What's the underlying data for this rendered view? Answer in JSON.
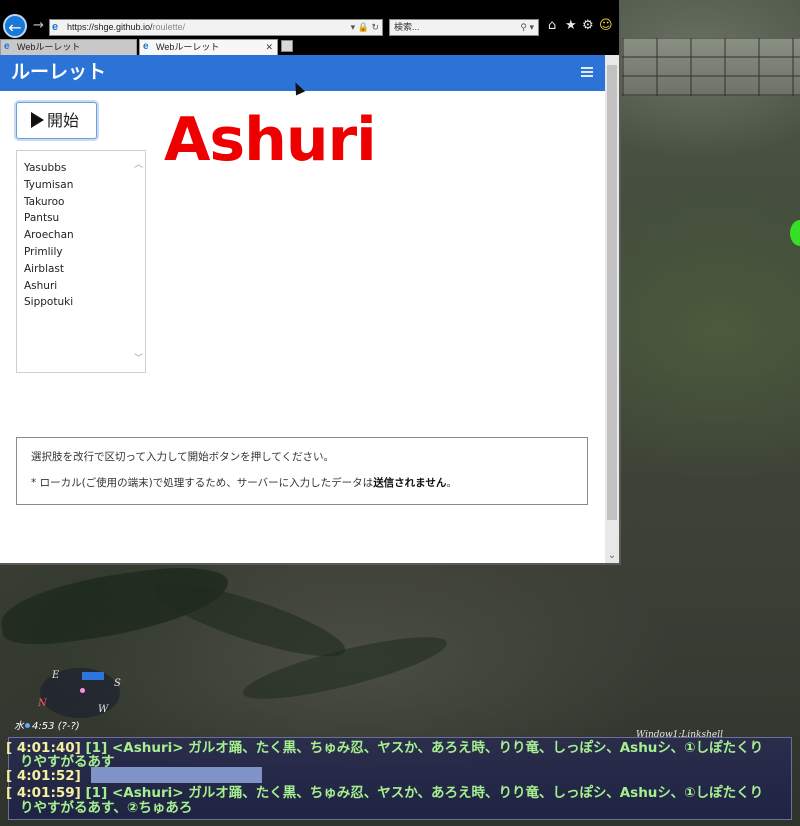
{
  "browser": {
    "url_host": "https://shge.github.io/",
    "url_path": "roulette/",
    "search_placeholder": "検索...",
    "tabs": [
      {
        "label": "Webルーレット",
        "active": false
      },
      {
        "label": "Webルーレット",
        "active": true
      }
    ]
  },
  "app": {
    "brand": "ルーレット",
    "start_label": "開始",
    "result": "Ashuri",
    "choices": [
      "Yasubbs",
      "Tyumisan",
      "Takuroo",
      "Pantsu",
      "Aroechan",
      "Primlily",
      "Airblast",
      "Ashuri",
      "Sippotuki"
    ],
    "info_line1": "選択肢を改行で区切って入力して開始ボタンを押してください。",
    "info_line2_pre": "* ローカル(ご使用の端末)で処理するため、サーバーに入力したデータは",
    "info_line2_bold": "送信されません",
    "info_line2_post": "。"
  },
  "game": {
    "compass_n": "N",
    "compass_e": "E",
    "compass_s": "S",
    "compass_w": "W",
    "clock_day": "水",
    "clock_time": "4:53 (?-?)",
    "window_label": "Window1:Linkshell",
    "chat": [
      {
        "time": "[ 4:01:40]",
        "text": " [1] <Ashuri> ガルオ踊、たく黒、ちゅみ忍、ヤスか、あろえ時、りり竜、しっぽシ、Ashuシ、①しぽたくり"
      },
      {
        "time": "",
        "text": "りやすがるあす"
      },
      {
        "time": "[ 4:01:52]",
        "text": ""
      },
      {
        "time": "[ 4:01:59]",
        "text": " [1] <Ashuri> ガルオ踊、たく黒、ちゅみ忍、ヤスか、あろえ時、りり竜、しっぽシ、Ashuシ、①しぽたくり"
      },
      {
        "time": "",
        "text": "りやすがるあす、②ちゅあろ"
      }
    ]
  },
  "colors": {
    "navbar": "#2b73d6",
    "result": "#ee0000",
    "chat_text": "#a6ef8f",
    "chat_time": "#f4f0a0"
  }
}
